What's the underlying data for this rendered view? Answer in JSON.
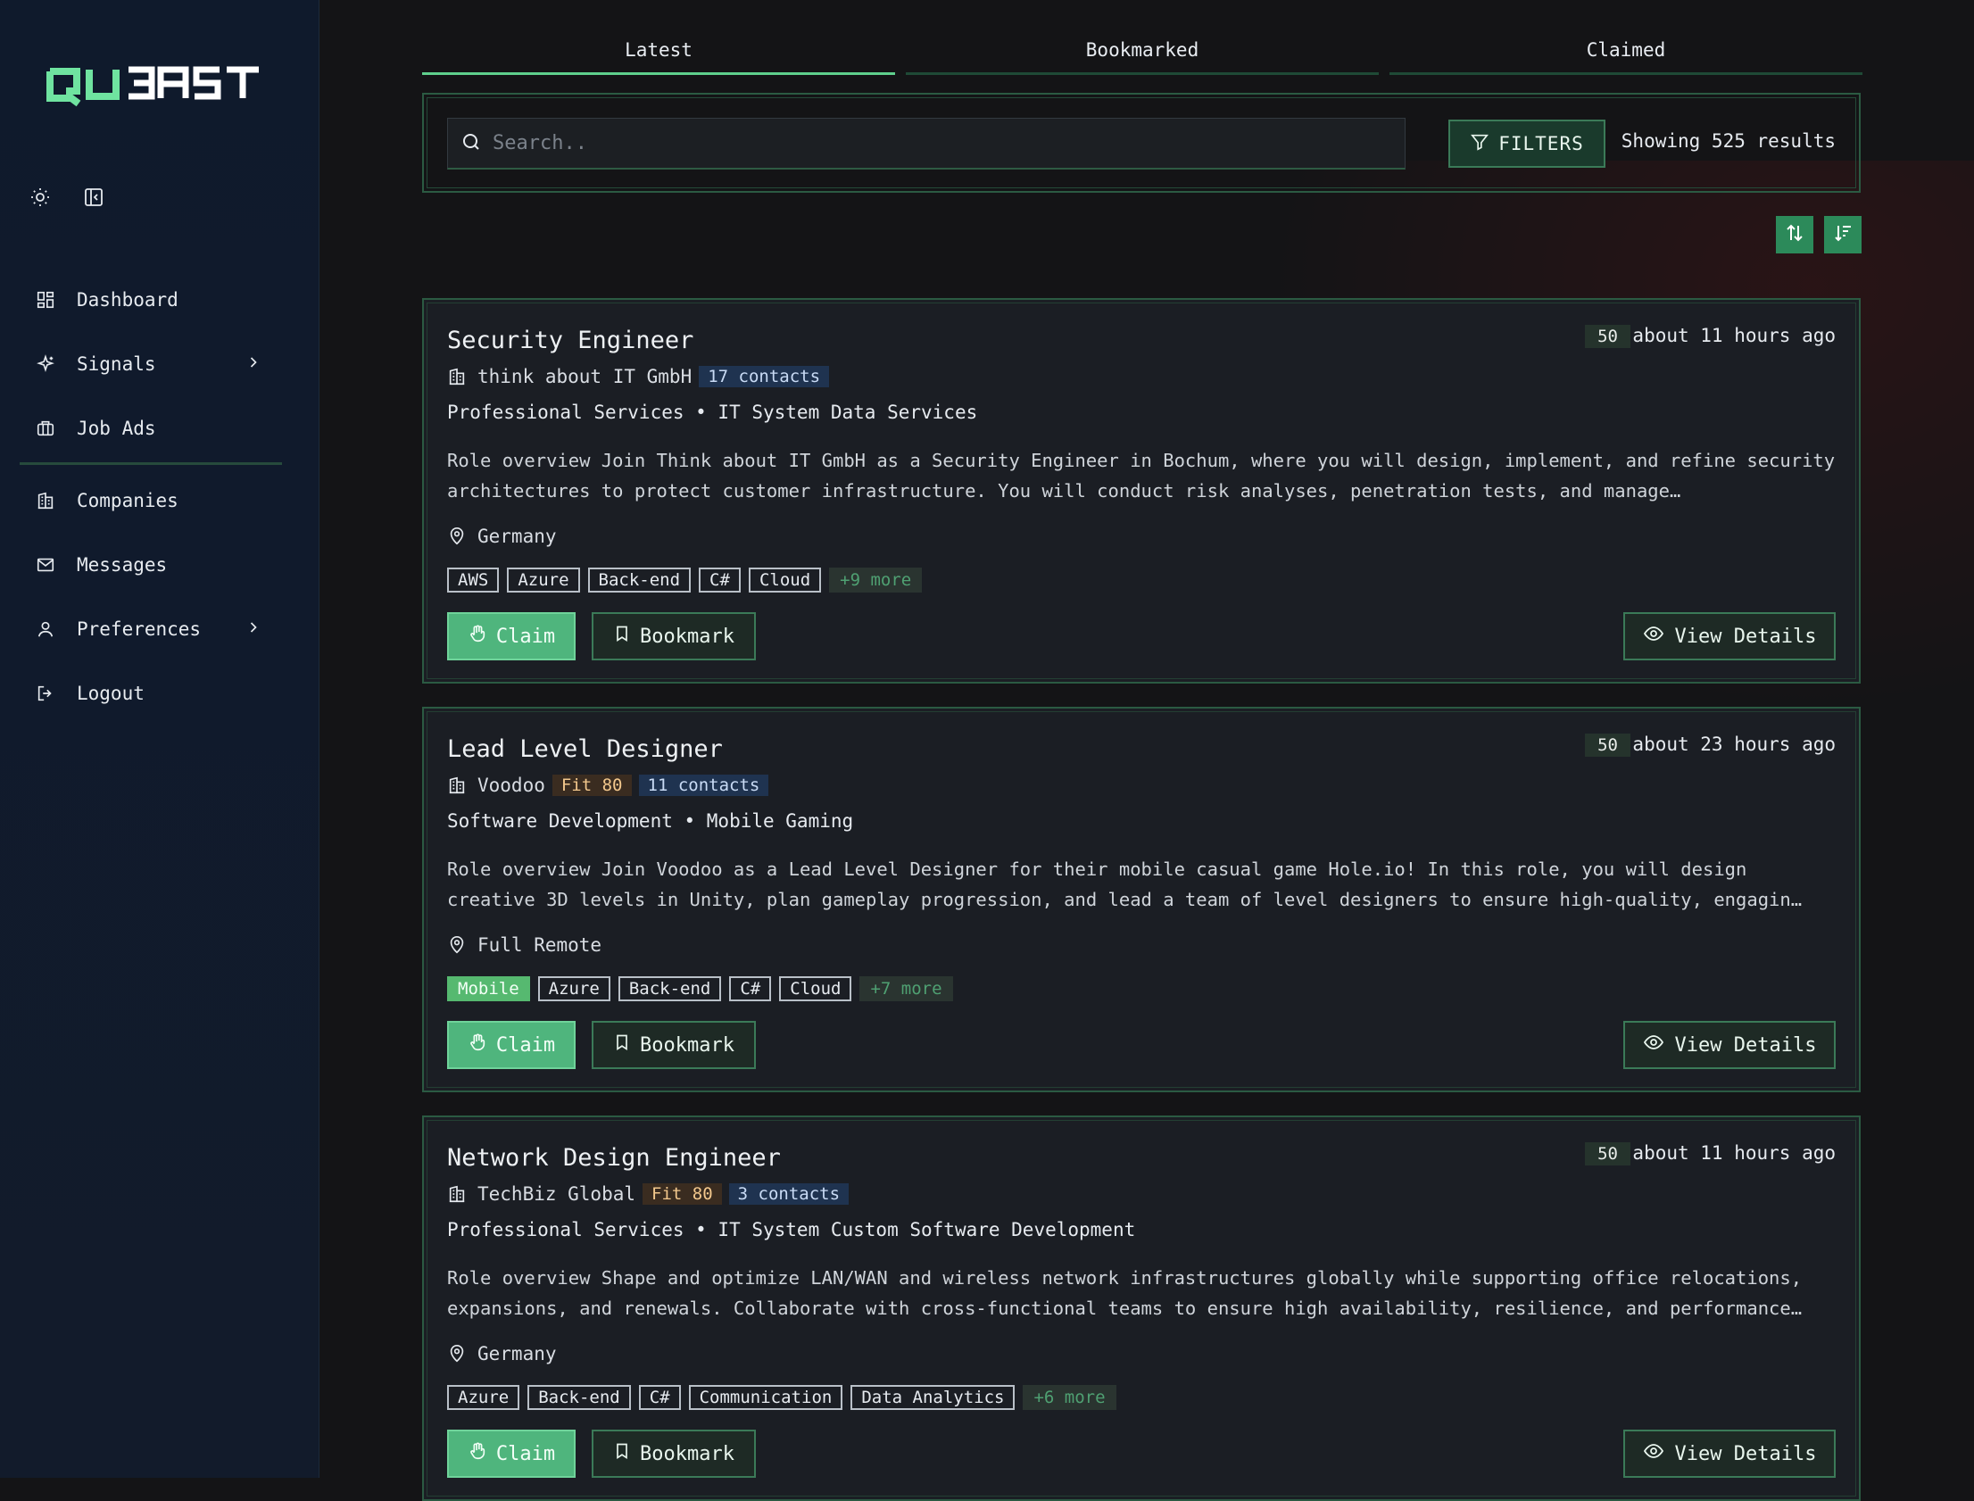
{
  "app": {
    "logo_text": "QUBAST"
  },
  "sidebar": {
    "items": [
      {
        "label": "Dashboard",
        "icon": "dashboard-icon"
      },
      {
        "label": "Signals",
        "icon": "sparkle-icon"
      },
      {
        "label": "Job Ads",
        "icon": "briefcase-icon"
      },
      {
        "label": "Companies",
        "icon": "building-icon"
      },
      {
        "label": "Messages",
        "icon": "mail-icon"
      },
      {
        "label": "Preferences",
        "icon": "user-icon"
      },
      {
        "label": "Logout",
        "icon": "logout-icon"
      }
    ]
  },
  "tabs": [
    {
      "label": "Latest",
      "active": true
    },
    {
      "label": "Bookmarked",
      "active": false
    },
    {
      "label": "Claimed",
      "active": false
    }
  ],
  "search": {
    "placeholder": "Search..",
    "filters_label": "FILTERS",
    "results_text": "Showing 525 results"
  },
  "actions": {
    "claim": "Claim",
    "bookmark": "Bookmark",
    "view": "View Details"
  },
  "jobs": [
    {
      "title": "Security Engineer",
      "score": "50",
      "time": "about 11 hours ago",
      "company": "think about IT GmbH",
      "fit": "",
      "contacts": "17 contacts",
      "industry": "Professional Services • IT System Data Services",
      "description": "Role overview Join Think about IT GmbH as a Security Engineer in Bochum, where you will design, implement, and refine security architectures to protect customer infrastructure. You will conduct risk analyses, penetration tests, and manage…",
      "location": "Germany",
      "tags": [
        "AWS",
        "Azure",
        "Back-end",
        "C#",
        "Cloud"
      ],
      "more": "+9 more"
    },
    {
      "title": "Lead Level Designer",
      "score": "50",
      "time": "about 23 hours ago",
      "company": "Voodoo",
      "fit": "Fit 80",
      "contacts": "11 contacts",
      "industry": "Software Development • Mobile Gaming",
      "description": "Role overview Join Voodoo as a Lead Level Designer for their mobile casual game Hole.io! In this role, you will design creative 3D levels in Unity, plan gameplay progression, and lead a team of level designers to ensure high-quality, engagin…",
      "location": "Full Remote",
      "tags": [
        "Mobile",
        "Azure",
        "Back-end",
        "C#",
        "Cloud"
      ],
      "more": "+7 more"
    },
    {
      "title": "Network Design Engineer",
      "score": "50",
      "time": "about 11 hours ago",
      "company": "TechBiz Global",
      "fit": "Fit 80",
      "contacts": "3 contacts",
      "industry": "Professional Services • IT System Custom Software Development",
      "description": "Role overview Shape and optimize LAN/WAN and wireless network infrastructures globally while supporting office relocations, expansions, and renewals. Collaborate with cross-functional teams to ensure high availability, resilience, and performance…",
      "location": "Germany",
      "tags": [
        "Azure",
        "Back-end",
        "C#",
        "Communication",
        "Data Analytics"
      ],
      "more": "+6 more"
    }
  ],
  "colors": {
    "accent": "#4fb57d",
    "sidebar_bg": "#0f1a2c",
    "card_border": "#2b5a42"
  }
}
